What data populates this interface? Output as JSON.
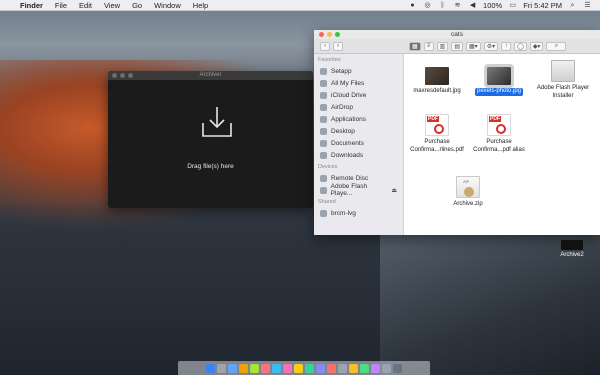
{
  "menubar": {
    "apple": "",
    "items": [
      "Finder",
      "File",
      "Edit",
      "View",
      "Go",
      "Window",
      "Help"
    ],
    "battery": "100%",
    "clock": "Fri 5:42 PM"
  },
  "archiver": {
    "title": "Archiver",
    "drop_label": "Drag file(s) here"
  },
  "finder": {
    "title": "cats",
    "sidebar": {
      "favorites_header": "Favorites",
      "favorites": [
        "Setapp",
        "All My Files",
        "iCloud Drive",
        "AirDrop",
        "Applications",
        "Desktop",
        "Documents",
        "Downloads"
      ],
      "devices_header": "Devices",
      "devices": [
        "Remote Disc",
        "Adobe Flash Playe..."
      ],
      "shared_header": "Shared",
      "shared": [
        "brcm-lvg"
      ]
    },
    "files": [
      {
        "name": "maxresdefault.jpg"
      },
      {
        "name": "pexels-photo.jpg"
      },
      {
        "name": "Adobe Flash Player Installer"
      },
      {
        "name": "Purchase Confirma...rlines.pdf"
      },
      {
        "name": "Purchase Confirma...pdf alias"
      },
      {
        "name": "Archive.zip"
      }
    ]
  },
  "desktop": {
    "item_label": "Archive2"
  }
}
